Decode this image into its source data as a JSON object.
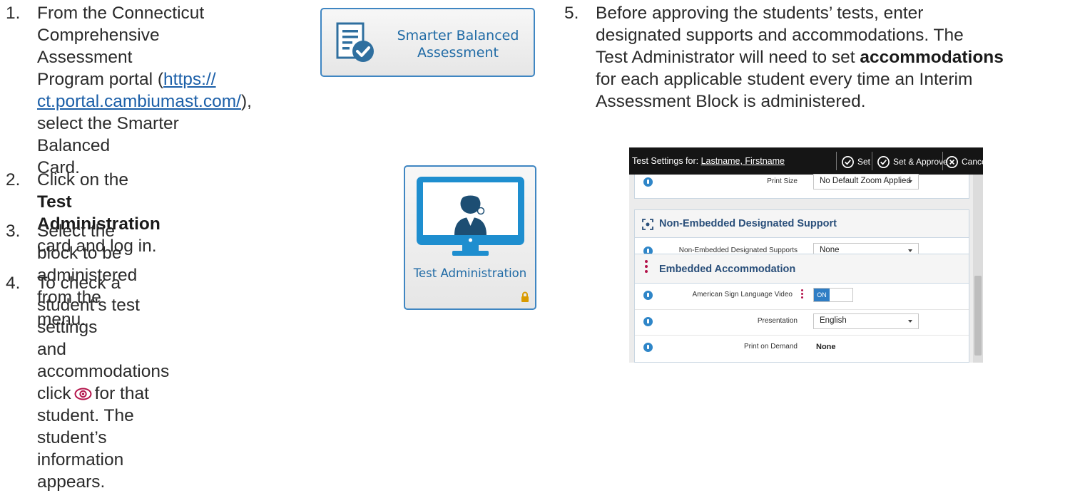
{
  "steps": [
    {
      "num": "1.",
      "lines": [
        "From the Connecticut",
        "Comprehensive Assessment",
        "Program portal (",
        "https://",
        "ct.portal.cambiumast.com/",
        "),",
        "select the Smarter Balanced",
        "Card."
      ]
    },
    {
      "num": "2.",
      "pre": "Click on the ",
      "bold": "Test Administration",
      "post": "card and log in."
    },
    {
      "num": "3.",
      "line1": "Select the block to be administered",
      "line2": "from the menu."
    },
    {
      "num": "4.",
      "line1": "To check a student’s test settings",
      "line2a": "and accommodations click",
      "line2b": "for that",
      "line3": "student. The student’s information appears.",
      "icon": "eye-icon"
    },
    {
      "num": "5.",
      "line1": "Before approving the students’ tests, enter",
      "line2": "designated supports and accommodations. The",
      "line3a": "Test Administrator will need to set ",
      "line3bold": "accommodations",
      "line4": "for each applicable student every time an Interim",
      "line5": "Assessment Block is administered."
    }
  ],
  "cards": {
    "smarter_balanced": {
      "line1": "Smarter Balanced",
      "line2": "Assessment",
      "icon": "document-check-icon"
    },
    "test_administration": {
      "title": "Test Administration",
      "icon": "monitor-person-icon",
      "lock": "lock-icon"
    }
  },
  "settings": {
    "title_prefix": "Test Settings for: ",
    "student_name": "Lastname, Firstname",
    "buttons": {
      "set": "Set",
      "set_approve": "Set & Approve",
      "cancel": "Cancel"
    },
    "print_size": {
      "label": "Print Size",
      "value": "No Default Zoom Applied"
    },
    "sections": {
      "non_embedded": "Non-Embedded Designated Support",
      "embedded": "Embedded Accommodation"
    },
    "non_embedded_row": {
      "label": "Non-Embedded Designated Supports",
      "value": "None"
    },
    "asl_row": {
      "label": "American Sign Language Video",
      "toggle": "ON"
    },
    "presentation_row": {
      "label": "Presentation",
      "value": "English"
    },
    "print_on_demand_row": {
      "label": "Print on Demand",
      "value": "None"
    }
  },
  "colors": {
    "link": "#1b5fa8",
    "card_text": "#1f6aa5",
    "card_border": "#3f86c2",
    "accent_magenta": "#b3134a"
  }
}
